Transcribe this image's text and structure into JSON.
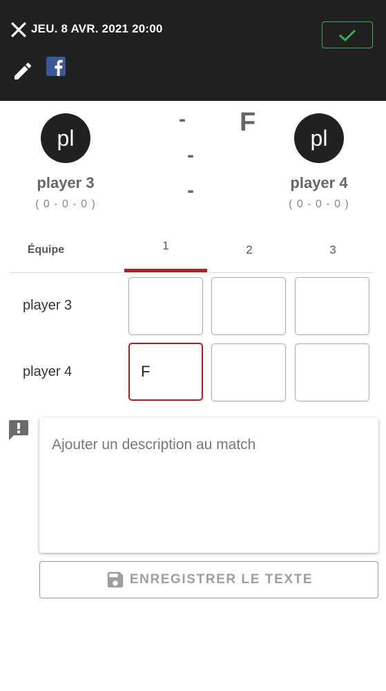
{
  "header": {
    "date": "JEU. 8 AVR. 2021 20:00"
  },
  "players": [
    {
      "initials": "pl",
      "name": "player 3",
      "stats": "( 0 - 0 - 0 )"
    },
    {
      "initials": "pl",
      "name": "player 4",
      "stats": "( 0 - 0 - 0 )"
    }
  ],
  "score": {
    "dashes": [
      "-",
      "-",
      "-"
    ],
    "mark": "F"
  },
  "table": {
    "team_header": "Équipe",
    "columns": [
      "1",
      "2",
      "3"
    ],
    "active_column": "1",
    "rows": [
      {
        "label": "player 3",
        "values": [
          "",
          "",
          ""
        ]
      },
      {
        "label": "player 4",
        "values": [
          "F",
          "",
          ""
        ]
      }
    ]
  },
  "description": {
    "placeholder": "Ajouter un description au match"
  },
  "save_button": {
    "label": "ENREGISTRER LE TEXTE"
  },
  "colors": {
    "header_bg": "#212121",
    "confirm": "#3fae49",
    "accent_red": "#b71c1c",
    "facebook": "#3b5998"
  }
}
